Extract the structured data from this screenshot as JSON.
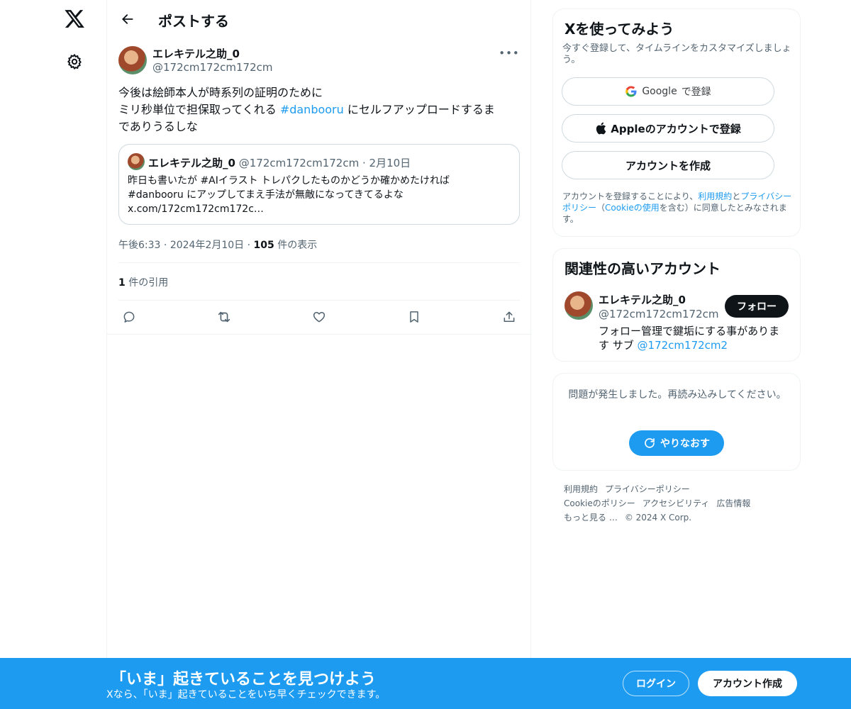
{
  "nav": {
    "logo_icon": "x-logo-icon",
    "settings_icon": "gear-icon"
  },
  "header": {
    "title": "ポストする"
  },
  "post": {
    "author_name": "エレキテル之助_0",
    "author_handle": "@172cm172cm172cm",
    "more_label": "•••",
    "text_line1": "今後は絵師本人が時系列の証明のために",
    "text_line2_pre": "ミリ秒単位で担保取ってくれる ",
    "text_hashtag": "#danbooru",
    "text_line2_post": " にセルフアップロードするま",
    "text_line3": "でありうるしな",
    "quote": {
      "author_name": "エレキテル之助_0",
      "author_handle": "@172cm172cm172cm",
      "dot": "·",
      "date": "2月10日",
      "text": "昨日も書いたが #AIイラスト トレパクしたものかどうか確かめたければ\n#danbooru にアップしてまえ手法が無敵になってきてるよな\nx.com/172cm172cm172c…"
    },
    "meta": {
      "time": "午後6:33",
      "sep1": "·",
      "date": "2024年2月10日",
      "sep2": "·",
      "views_count": "105",
      "views_label": "件の表示"
    },
    "quotes": {
      "count": "1",
      "label": "件の引用"
    }
  },
  "signup_card": {
    "title": "Xを使ってみよう",
    "subtitle": "今すぐ登録して、タイムラインをカスタマイズしましょう。",
    "google_brand": "Google",
    "google_suffix": "で登録",
    "apple_label": "Appleのアカウントで登録",
    "create_label": "アカウントを作成",
    "legal_pre": "アカウントを登録することにより、",
    "legal_terms": "利用規約",
    "legal_and": "と",
    "legal_privacy": "プライバシーポリシー",
    "legal_mid": "（",
    "legal_cookie": "Cookieの使用",
    "legal_post": "を含む）に同意したとみなされます。"
  },
  "related_card": {
    "title": "関連性の高いアカウント",
    "name": "エレキテル之助_0",
    "handle": "@172cm172cm172cm",
    "follow_label": "フォロー",
    "bio_pre": "フォロー管理で鍵垢にする事があります サブ ",
    "bio_link": "@172cm172cm2"
  },
  "error_card": {
    "message": "問題が発生しました。再読み込みしてください。",
    "retry_label": "やりなおす"
  },
  "footer": {
    "terms": "利用規約",
    "privacy": "プライバシーポリシー",
    "cookie": "Cookieのポリシー",
    "accessibility": "アクセシビリティ",
    "ads": "広告情報",
    "more": "もっと見る …",
    "copyright": "© 2024 X Corp."
  },
  "bottom_bar": {
    "title": "「いま」起きていることを見つけよう",
    "subtitle": "Xなら、「いま」起きていることをいち早くチェックできます。",
    "login_label": "ログイン",
    "create_label": "アカウント作成"
  },
  "colors": {
    "accent": "#1d9bf0",
    "text": "#0f1419",
    "muted": "#536471",
    "border": "#eff3f4"
  }
}
